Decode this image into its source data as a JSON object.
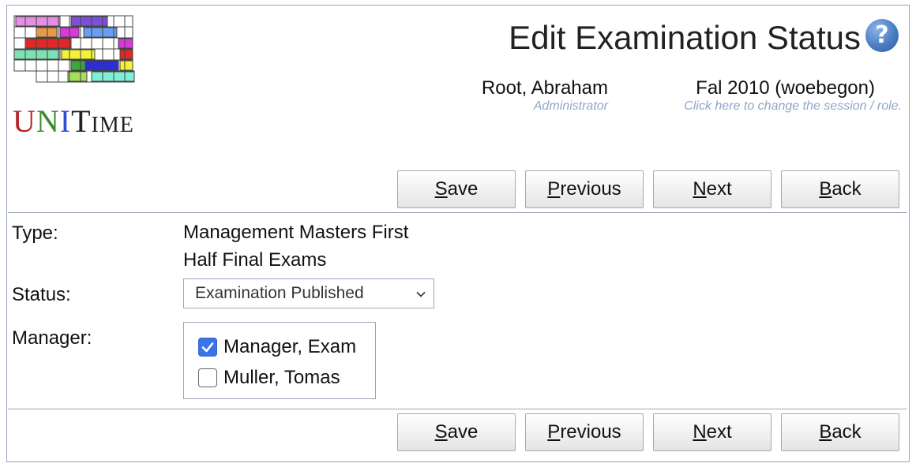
{
  "app": {
    "name_first": "U",
    "name_ni": "N",
    "name_i": "I",
    "name_time": "Time"
  },
  "header": {
    "title": "Edit Examination Status",
    "help_label": "?",
    "user_name": "Root, Abraham",
    "user_role": "Administrator",
    "session": "Fal 2010 (woebegon)",
    "session_hint": "Click here to change the session / role."
  },
  "buttons": [
    {
      "accel": "S",
      "rest": "ave"
    },
    {
      "accel": "P",
      "rest": "revious"
    },
    {
      "accel": "N",
      "rest": "ext"
    },
    {
      "accel": "B",
      "rest": "ack"
    }
  ],
  "form": {
    "type_label": "Type:",
    "type_value": "Management Masters First Half Final Exams",
    "status_label": "Status:",
    "status_value": "Examination Published",
    "manager_label": "Manager:",
    "managers": [
      {
        "name": "Manager, Exam",
        "checked": true
      },
      {
        "name": "Muller, Tomas",
        "checked": false
      }
    ]
  },
  "colors": {
    "accent": "#3b74e6",
    "border": "#9aa3bd",
    "hint": "#8fa6c8"
  }
}
